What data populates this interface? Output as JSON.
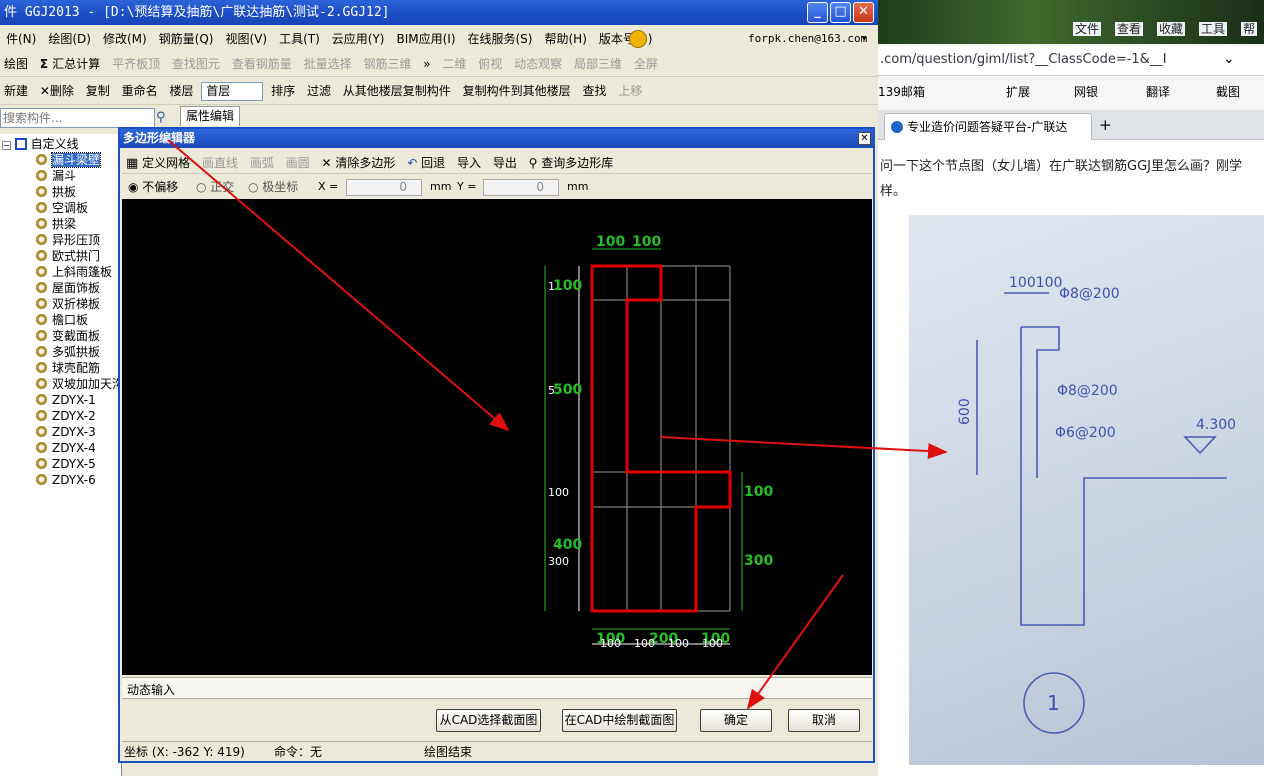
{
  "app": {
    "title": "件 GGJ2013 - [D:\\预结算及抽筋\\广联达抽筋\\测试-2.GGJ12]",
    "min_glyph": "_",
    "max_glyph": "□",
    "close_glyph": "✕",
    "menu": [
      "件(N)",
      "绘图(D)",
      "修改(M)",
      "钢筋量(Q)",
      "视图(V)",
      "工具(T)",
      "云应用(Y)",
      "BIM应用(I)",
      "在线服务(S)",
      "帮助(H)",
      "版本号(B)"
    ],
    "account": "forpk.chen@163.com",
    "toolbar1": {
      "draw": "绘图",
      "sum": "汇总计算",
      "flat": "平齐板顶",
      "find_elem": "查找图元",
      "view_rebar": "查看钢筋量",
      "batch": "批量选择",
      "rebar3d": "钢筋三维",
      "view2d": "二维",
      "plan": "俯视",
      "dynamic": "动态观察",
      "local3d": "局部三维",
      "fullscreen": "全屏"
    },
    "toolbar2": {
      "new": "新建",
      "delete": "删除",
      "copy": "复制",
      "rename": "重命名",
      "floor_label": "楼层",
      "floor_value": "首层",
      "sort": "排序",
      "filter": "过滤",
      "copy_from": "从其他楼层复制构件",
      "copy_to": "复制构件到其他楼层",
      "find": "查找",
      "up": "上移"
    },
    "search_placeholder": "搜索构件...",
    "tab_label": "属性编辑",
    "tree_root": "自定义线",
    "tree_items": [
      "漏斗梁壁",
      "漏斗",
      "拱板",
      "空调板",
      "拱梁",
      "异形压顶",
      "欧式拱门",
      "上斜雨篷板",
      "屋面饰板",
      "双折梯板",
      "檐口板",
      "变截面板",
      "多弧拱板",
      "球壳配筋",
      "双坡加加天沟",
      "ZDYX-1",
      "ZDYX-2",
      "ZDYX-3",
      "ZDYX-4",
      "ZDYX-5",
      "ZDYX-6"
    ]
  },
  "dialog": {
    "title": "多边形编辑器",
    "close_glyph": "✕",
    "tools": {
      "grid": "定义网格",
      "line": "画直线",
      "arc": "画弧",
      "circle": "画圆",
      "clear": "清除多边形",
      "undo": "回退",
      "import": "导入",
      "export": "导出",
      "library": "查询多边形库"
    },
    "options": {
      "no_offset": "不偏移",
      "ortho": "正交",
      "polar": "极坐标",
      "x_label": "X =",
      "x_value": "0",
      "y_label": "Y =",
      "y_value": "0",
      "unit": "mm"
    },
    "dynamic_input": "动态输入",
    "buttons": {
      "from_cad": "从CAD选择截面图",
      "draw_in_cad": "在CAD中绘制截面图",
      "ok": "确定",
      "cancel": "取消"
    },
    "status": {
      "coords": "坐标 (X: -362 Y: 419)",
      "command": "命令：无",
      "message": "绘图结束"
    },
    "drawing": {
      "top_dims": [
        "100",
        "100"
      ],
      "left_green": [
        "100",
        "500",
        "400"
      ],
      "left_white": [
        "1",
        "5",
        "100",
        "300"
      ],
      "right_green": [
        "100",
        "300"
      ],
      "bottom_green": [
        "100",
        "200",
        "100"
      ],
      "bottom_white": [
        "100",
        "100",
        "100",
        "100"
      ]
    }
  },
  "browser": {
    "menu": [
      "文件",
      "查看",
      "收藏",
      "工具",
      "帮"
    ],
    "url": ".com/question/giml/list?__ClassCode=-1&__I",
    "bookmarks": [
      "139邮箱",
      "扩展",
      "网银",
      "翻译",
      "截图"
    ],
    "tab_title": "专业造价问题答疑平台-广联达",
    "new_tab_glyph": "+",
    "question_line1": "问一下这个节点图（女儿墙）在广联达钢筋GGJ里怎么画？刚学",
    "question_line2": "样。",
    "sketch": {
      "dims_top": "100100",
      "bar1": "Φ8@200",
      "bar2": "Φ8@200",
      "bar3": "Φ6@200",
      "height": "600",
      "elevation": "4.300",
      "circle_no": "1"
    }
  },
  "colors": {
    "title_blue": "#1b4cc3",
    "polygon_red": "#e00000",
    "dim_green": "#22c022",
    "arrow_red": "#e01010"
  }
}
